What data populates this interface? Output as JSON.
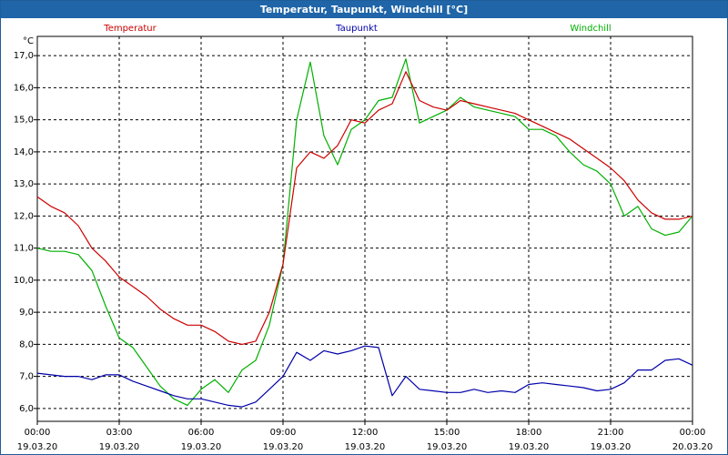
{
  "window": {
    "title": "Temperatur, Taupunkt, Windchill [°C]"
  },
  "colors": {
    "temperature": "#cc0000",
    "dewpoint": "#0000aa",
    "windchill": "#00b000",
    "titlebar": "#1f65a8"
  },
  "chart_data": {
    "type": "line",
    "y_unit": "°C",
    "ylim": [
      5.6,
      17.6
    ],
    "y_ticks": [
      "6,0",
      "7,0",
      "8,0",
      "9,0",
      "10,0",
      "11,0",
      "12,0",
      "13,0",
      "14,0",
      "15,0",
      "16,0",
      "17,0"
    ],
    "xlim": [
      0,
      24
    ],
    "x_ticks": [
      {
        "time": "00:00",
        "date": "19.03.20"
      },
      {
        "time": "03:00",
        "date": "19.03.20"
      },
      {
        "time": "06:00",
        "date": "19.03.20"
      },
      {
        "time": "09:00",
        "date": "19.03.20"
      },
      {
        "time": "12:00",
        "date": "19.03.20"
      },
      {
        "time": "15:00",
        "date": "19.03.20"
      },
      {
        "time": "18:00",
        "date": "19.03.20"
      },
      {
        "time": "21:00",
        "date": "19.03.20"
      },
      {
        "time": "00:00",
        "date": "20.03.20"
      }
    ],
    "grid": true,
    "legend_position": "top",
    "x": [
      0,
      0.5,
      1,
      1.5,
      2,
      2.5,
      3,
      3.5,
      4,
      4.5,
      5,
      5.5,
      6,
      6.5,
      7,
      7.5,
      8,
      8.5,
      9,
      9.5,
      10,
      10.5,
      11,
      11.5,
      12,
      12.5,
      13,
      13.5,
      14,
      14.5,
      15,
      15.5,
      16,
      16.5,
      17,
      17.5,
      18,
      18.5,
      19,
      19.5,
      20,
      20.5,
      21,
      21.5,
      22,
      22.5,
      23,
      23.5,
      24
    ],
    "series": [
      {
        "name": "Temperatur",
        "color": "#cc0000",
        "values": [
          12.6,
          12.3,
          12.1,
          11.7,
          11.0,
          10.6,
          10.1,
          9.8,
          9.5,
          9.1,
          8.8,
          8.6,
          8.6,
          8.4,
          8.1,
          8.0,
          8.1,
          9.0,
          10.5,
          13.5,
          14.0,
          13.8,
          14.2,
          15.0,
          14.9,
          15.3,
          15.5,
          16.5,
          15.6,
          15.4,
          15.3,
          15.6,
          15.5,
          15.4,
          15.3,
          15.2,
          15.0,
          14.8,
          14.6,
          14.4,
          14.1,
          13.8,
          13.5,
          13.1,
          12.5,
          12.1,
          11.9,
          11.9,
          12.0
        ]
      },
      {
        "name": "Taupunkt",
        "color": "#0000aa",
        "values": [
          7.1,
          7.05,
          7.0,
          7.0,
          6.9,
          7.05,
          7.05,
          6.85,
          6.7,
          6.55,
          6.4,
          6.3,
          6.3,
          6.2,
          6.1,
          6.05,
          6.2,
          6.6,
          7.0,
          7.75,
          7.5,
          7.8,
          7.7,
          7.8,
          7.95,
          7.9,
          6.4,
          7.0,
          6.6,
          6.55,
          6.5,
          6.5,
          6.6,
          6.5,
          6.55,
          6.5,
          6.75,
          6.8,
          6.75,
          6.7,
          6.65,
          6.55,
          6.6,
          6.8,
          7.2,
          7.2,
          7.5,
          7.55,
          7.35
        ]
      },
      {
        "name": "Windchill",
        "color": "#00b000",
        "values": [
          11.0,
          10.9,
          10.9,
          10.8,
          10.3,
          9.2,
          8.2,
          7.9,
          7.3,
          6.7,
          6.3,
          6.1,
          6.6,
          6.9,
          6.5,
          7.2,
          7.5,
          8.6,
          10.5,
          15.0,
          16.8,
          14.5,
          13.6,
          14.7,
          15.0,
          15.6,
          15.7,
          16.9,
          14.9,
          15.1,
          15.3,
          15.7,
          15.4,
          15.3,
          15.2,
          15.1,
          14.7,
          14.7,
          14.5,
          14.0,
          13.6,
          13.4,
          13.0,
          12.0,
          12.3,
          11.6,
          11.4,
          11.5,
          12.0
        ]
      }
    ]
  }
}
